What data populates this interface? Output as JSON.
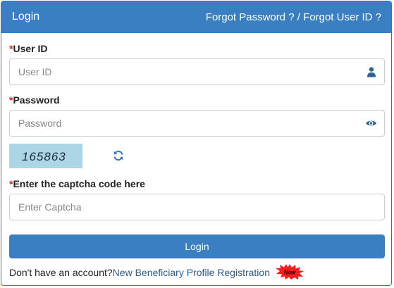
{
  "header": {
    "title": "Login",
    "forgot_link": "Forgot Password ? / Forgot User ID ?"
  },
  "form": {
    "userid": {
      "required_mark": "*",
      "label": "User ID",
      "placeholder": "User ID",
      "value": "",
      "icon": "user-icon"
    },
    "password": {
      "required_mark": "*",
      "label": "Password",
      "placeholder": "Password",
      "value": "",
      "icon": "eye-icon"
    },
    "captcha": {
      "code": "165863",
      "refresh_icon": "refresh-icon",
      "required_mark": "*",
      "label": "Enter the captcha code here",
      "placeholder": "Enter Captcha",
      "value": ""
    },
    "login_button": "Login"
  },
  "footer": {
    "text": "Don't have an account?",
    "link": "New Beneficiary Profile Registration",
    "badge": "New"
  },
  "colors": {
    "primary": "#3a7fc1",
    "required": "#d9231f",
    "captcha_bg": "#acd6e6",
    "badge": "#ff1a1a"
  }
}
